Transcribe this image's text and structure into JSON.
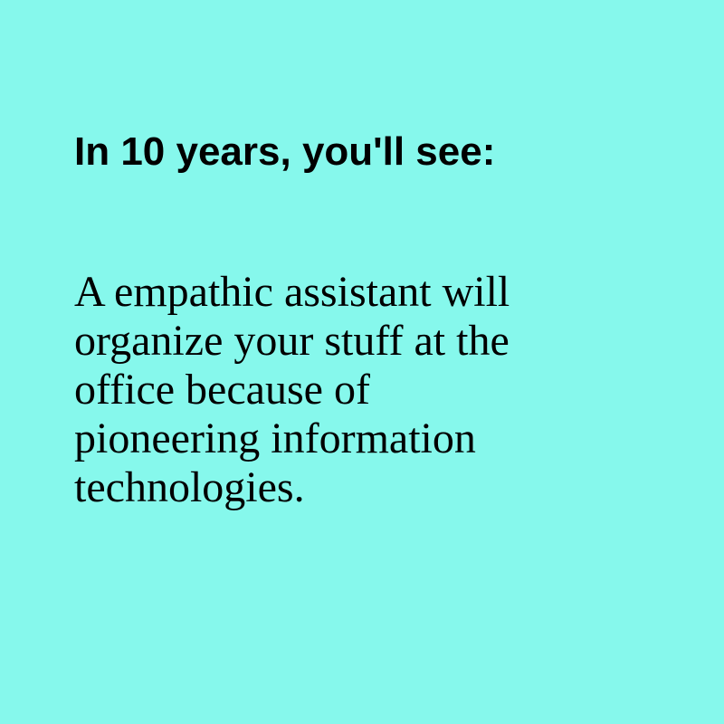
{
  "theme": {
    "background": "#86F8EC",
    "text_color": "#000000"
  },
  "heading": "In 10 years, you'll see:",
  "body_lines": [
    "A empathic assistant will",
    "organize your stuff at the",
    "office because of",
    "pioneering information",
    "technologies."
  ]
}
